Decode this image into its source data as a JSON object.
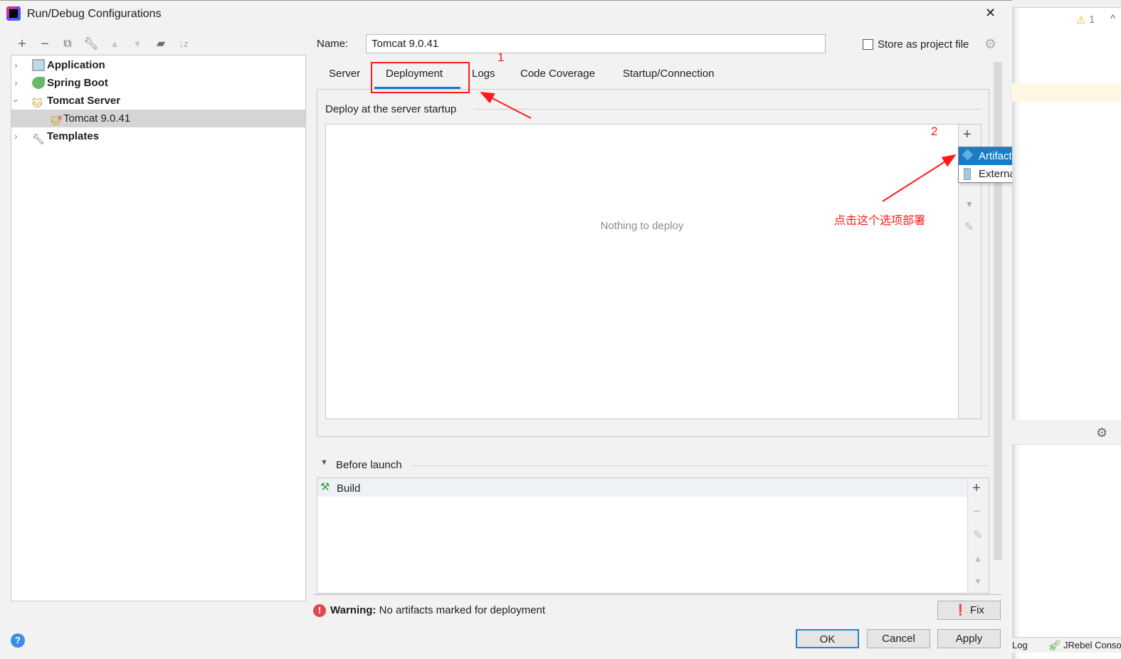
{
  "window": {
    "title": "Run/Debug Configurations",
    "close": "✕"
  },
  "tree": [
    {
      "label": "Application",
      "icon": "application-icon"
    },
    {
      "label": "Spring Boot",
      "icon": "spring-boot-icon"
    },
    {
      "label": "Tomcat Server",
      "icon": "tomcat-icon"
    },
    {
      "label": "Tomcat 9.0.41",
      "icon": "tomcat-error-icon"
    },
    {
      "label": "Templates",
      "icon": "wrench-icon"
    }
  ],
  "name": {
    "label": "Name:",
    "value": "Tomcat 9.0.41"
  },
  "store": {
    "label": "Store as project file",
    "checked": false
  },
  "tabs": [
    "Server",
    "Deployment",
    "Logs",
    "Code Coverage",
    "Startup/Connection"
  ],
  "active_tab": "Deployment",
  "deploy": {
    "title": "Deploy at the server startup",
    "empty": "Nothing to deploy"
  },
  "menu": {
    "items": [
      "Artifact...",
      "External Source..."
    ]
  },
  "before_launch": {
    "title": "Before launch",
    "items": [
      "Build"
    ]
  },
  "warning": {
    "bold": "Warning:",
    "text": "No artifacts marked for deployment",
    "fix": "Fix"
  },
  "buttons": {
    "ok": "OK",
    "cancel": "Cancel",
    "apply": "Apply"
  },
  "annotations": {
    "one": "1",
    "two": "2",
    "note": "点击这个选项部署"
  },
  "background": {
    "warning_count": "1",
    "log": "Log",
    "jrebel": "JRebel Conso"
  },
  "colors": {
    "accent": "#1a7dc4",
    "annotation": "#ff1a1a"
  }
}
